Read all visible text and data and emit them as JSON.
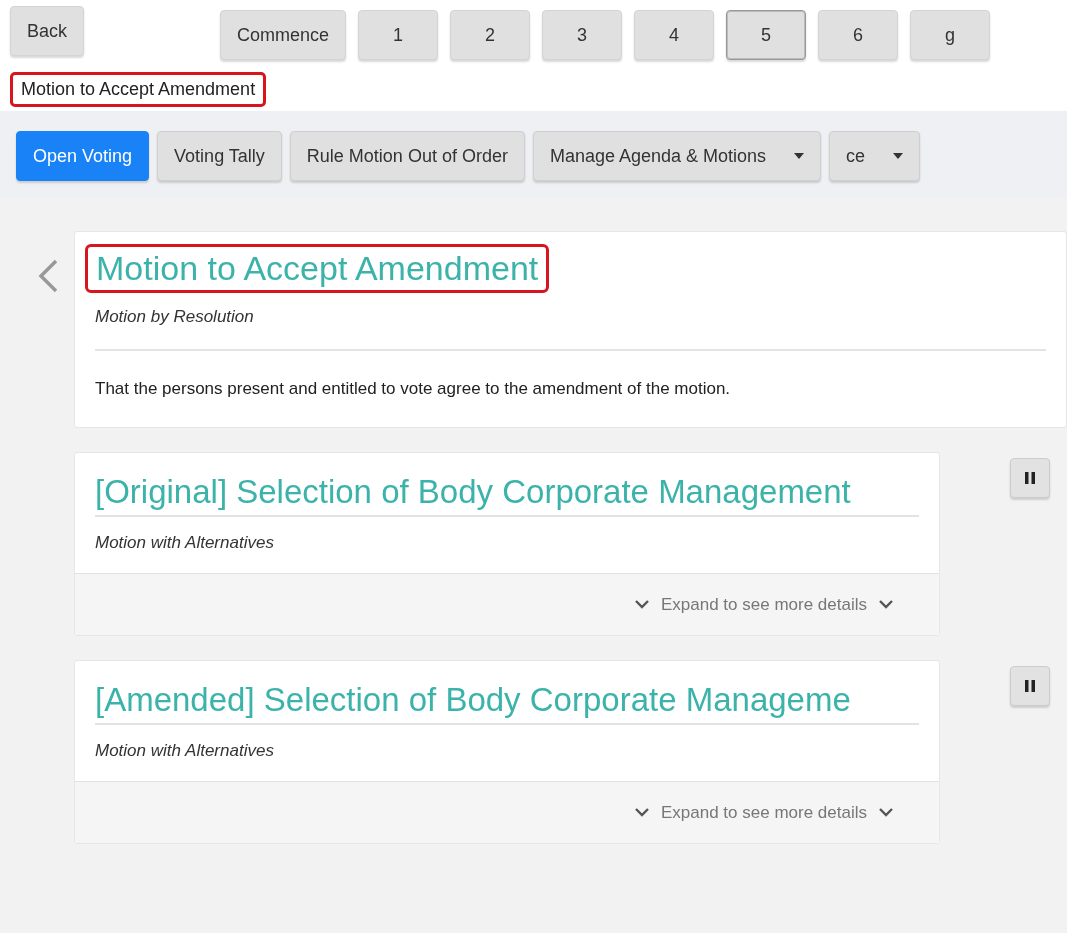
{
  "nav": {
    "back": "Back",
    "steps": [
      {
        "label": "Commence",
        "selected": false
      },
      {
        "label": "1",
        "selected": false
      },
      {
        "label": "2",
        "selected": false
      },
      {
        "label": "3",
        "selected": false
      },
      {
        "label": "4",
        "selected": false
      },
      {
        "label": "5",
        "selected": true
      },
      {
        "label": "6",
        "selected": false
      },
      {
        "label": "g",
        "selected": false
      }
    ]
  },
  "breadcrumb": {
    "text": "Motion to Accept Amendment",
    "highlighted": true
  },
  "toolbar": [
    {
      "label": "Open Voting",
      "kind": "primary"
    },
    {
      "label": "Voting Tally",
      "kind": "plain"
    },
    {
      "label": "Rule Motion Out of Order",
      "kind": "plain"
    },
    {
      "label": "Manage Agenda & Motions",
      "kind": "dropdown"
    },
    {
      "label": "ce",
      "kind": "dropdown"
    }
  ],
  "current": {
    "title": "Motion to Accept Amendment",
    "highlighted": true,
    "type": "Motion by Resolution",
    "text": "That the persons present and entitled to vote agree to the amendment of the motion."
  },
  "motions": [
    {
      "title": "[Original] Selection of Body Corporate Management",
      "type": "Motion with Alternatives",
      "expand": "Expand to see more details"
    },
    {
      "title": "[Amended] Selection of Body Corporate Manageme",
      "type": "Motion with Alternatives",
      "expand": "Expand to see more details"
    }
  ]
}
